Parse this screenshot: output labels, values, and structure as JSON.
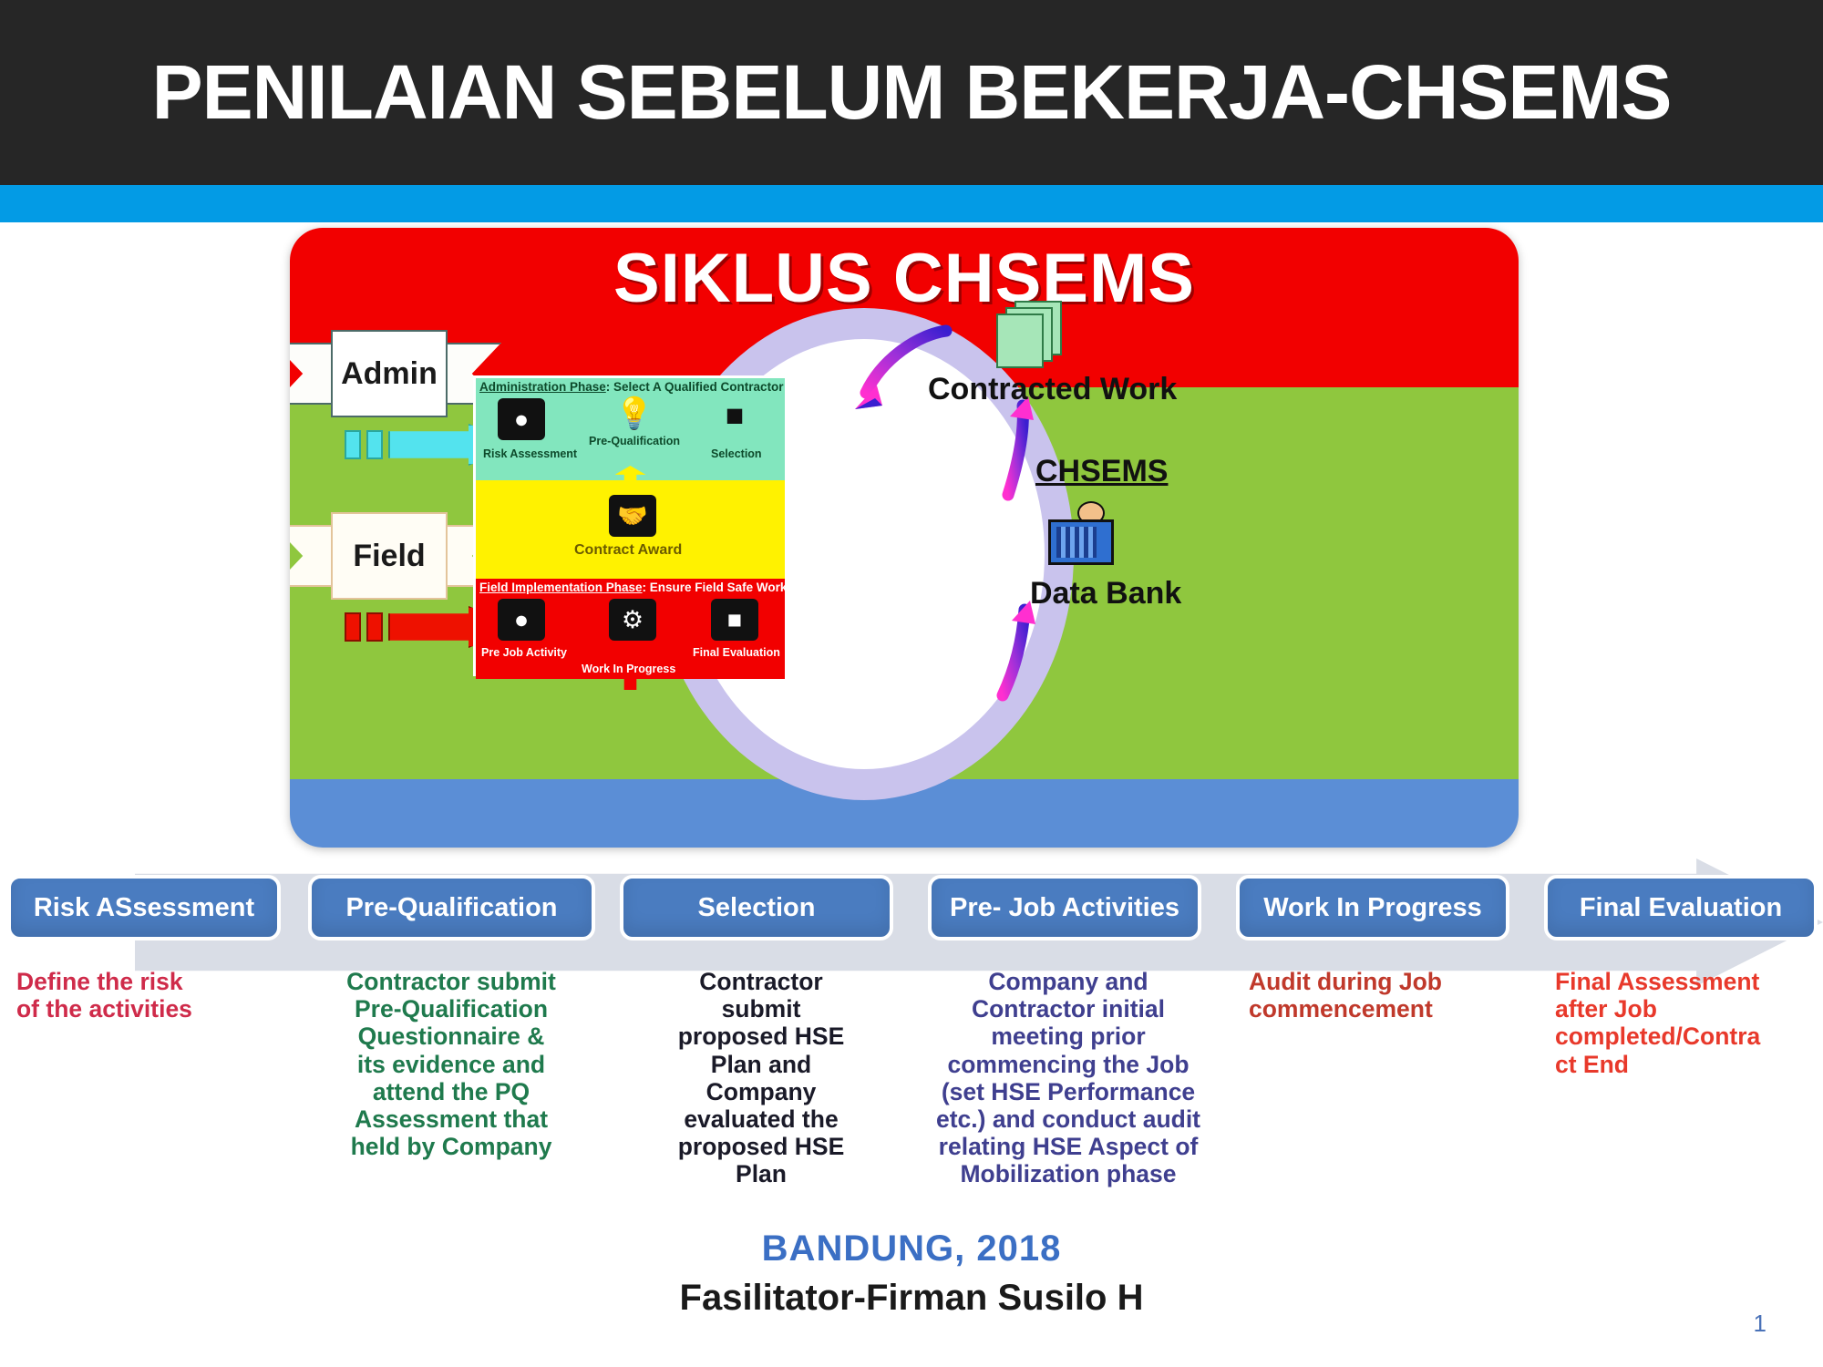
{
  "slide": {
    "title": "PENILAIAN SEBELUM BEKERJA-CHSEMS",
    "page_number": "1",
    "accent_color": "#039be5",
    "header_bg": "#262626"
  },
  "diagram": {
    "title": "SIKLUS CHSEMS",
    "bands": {
      "top": "#f20000",
      "middle": "#8fc73e",
      "bottom": "#5b8ed6"
    },
    "ribbons": [
      {
        "label": "Admin"
      },
      {
        "label": "Field"
      }
    ],
    "arrows": [
      {
        "name": "admin-arrow",
        "color": "#53e3ee"
      },
      {
        "name": "field-arrow",
        "color": "#ee1100"
      }
    ],
    "phase_panel": {
      "admin_phase": {
        "heading_underlined": "Administration Phase",
        "heading_rest": ": Select A Qualified Contractor",
        "items": [
          {
            "label": "Risk Assessment",
            "icon": "crystal-ball-icon"
          },
          {
            "label": "Pre-Qualification",
            "icon": "lightbulb-icon"
          },
          {
            "label": "Selection",
            "icon": "podium-icon"
          }
        ]
      },
      "award_phase": {
        "label": "Contract Award",
        "icon": "handshake-icon"
      },
      "field_phase": {
        "heading_underlined": "Field Implementation Phase",
        "heading_rest": ": Ensure Field Safe Work",
        "items": [
          {
            "label": "Pre Job Activity",
            "icon": "head-profile-icon"
          },
          {
            "label": "Work In Progress",
            "icon": "gears-icon"
          },
          {
            "label": "Final Evaluation",
            "icon": "report-pen-icon"
          }
        ]
      }
    },
    "right_cluster": {
      "contracted_work": "Contracted Work",
      "chsems": "CHSEMS",
      "data_bank": "Data Bank",
      "docs_icon": "documents-icon",
      "bank_icon": "data-bank-icon"
    }
  },
  "process": {
    "steps": [
      {
        "label": "Risk ASsessment",
        "desc": "Define the risk\nof the activities",
        "desc_color": "#cf2b4a",
        "align": "left"
      },
      {
        "label": "Pre-Qualification",
        "desc": "Contractor submit\nPre-Qualification\nQuestionnaire &\nits evidence and\nattend the PQ\nAssessment that\nheld by Company",
        "desc_color": "#1f7a4d",
        "align": "center"
      },
      {
        "label": "Selection",
        "desc": "Contractor\nsubmit\nproposed HSE\nPlan and\nCompany\nevaluated the\nproposed HSE\nPlan",
        "desc_color": "#1a1a28",
        "align": "center"
      },
      {
        "label": "Pre- Job Activities",
        "desc": "Company and\nContractor initial\nmeeting prior\ncommencing the Job\n(set HSE Performance\netc.) and conduct audit\nrelating HSE Aspect of\nMobilization phase",
        "desc_color": "#3f3f8f",
        "align": "center"
      },
      {
        "label": "Work In Progress",
        "desc": "Audit during Job\ncommencement",
        "desc_color": "#c0392b",
        "align": "left"
      },
      {
        "label": "Final Evaluation",
        "desc": "Final Assessment\nafter Job\ncompleted/Contra\nct End",
        "desc_color": "#e8392b",
        "align": "left"
      }
    ],
    "box_color": "#4a7cc0",
    "strip_color": "#d9dde6"
  },
  "footer": {
    "city_year": "BANDUNG, 2018",
    "facilitator": "Fasilitator-Firman Susilo H",
    "city_color": "#3b6fc4"
  }
}
